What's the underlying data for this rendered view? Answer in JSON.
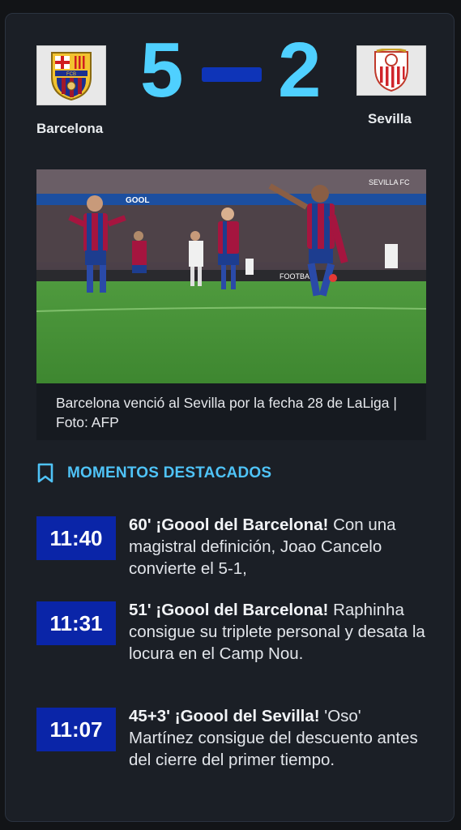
{
  "match": {
    "home": {
      "name": "Barcelona",
      "score": "5",
      "crest_text": "FCB"
    },
    "away": {
      "name": "Sevilla",
      "score": "2"
    }
  },
  "photo": {
    "caption": "Barcelona venció al Sevilla por la fecha 28 de LaLiga | Foto: AFP",
    "banner_text": "GOOL",
    "banner_text_2": "SEVILLA FC",
    "sponsor": "FOOTBAL"
  },
  "highlights": {
    "title": "MOMENTOS DESTACADOS",
    "icon": "bookmark-icon",
    "items": [
      {
        "time": "11:40",
        "headline": "60' ¡Goool del Barcelona!",
        "text": "Con una magistral definición, Joao Cancelo convierte el 5-1,"
      },
      {
        "time": "11:31",
        "headline": "51' ¡Goool del Barcelona!",
        "text": "Raphinha consigue su triplete personal y desata la locura en el Camp Nou."
      },
      {
        "time": "11:07",
        "headline": "45+3' ¡Goool del Sevilla!",
        "text": "'Oso' Martínez consigue del descuento antes del cierre del primer tiempo."
      }
    ]
  },
  "colors": {
    "accent": "#4fd0ff",
    "badge": "#0a25a8",
    "card": "#1b1f26"
  }
}
